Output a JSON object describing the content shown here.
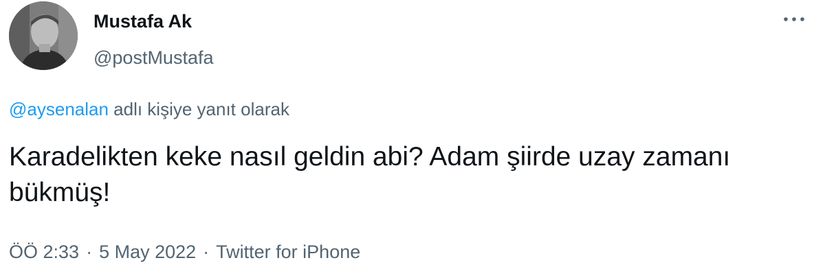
{
  "author": {
    "display_name": "Mustafa Ak",
    "handle": "@postMustafa"
  },
  "reply": {
    "mention": "@aysenalan",
    "suffix": " adlı kişiye yanıt olarak"
  },
  "tweet": {
    "text": "Karadelikten keke nasıl geldin abi? Adam şiirde uzay zamanı bükmüş!"
  },
  "meta": {
    "time": "ÖÖ 2:33",
    "separator": "·",
    "date": "5 May 2022",
    "source": "Twitter for iPhone"
  },
  "icons": {
    "more": "more-horizontal-icon",
    "avatar": "profile-photo"
  },
  "colors": {
    "text_primary": "#0f1419",
    "text_secondary": "#536471",
    "link": "#1d9bf0"
  }
}
